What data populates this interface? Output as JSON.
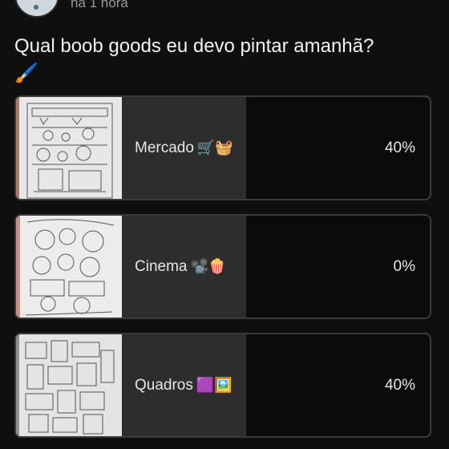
{
  "post": {
    "time": "há 1 hora",
    "question": "Qual boob goods eu devo pintar amanhã?",
    "question_emoji": "🖌️"
  },
  "poll": {
    "options": [
      {
        "label": "Mercado",
        "emoji": "🛒🧺",
        "percent": "40%",
        "fill_fraction": 0.55,
        "image": "coloring-page-thumbnail"
      },
      {
        "label": "Cinema",
        "emoji": "📽️🍿",
        "percent": "0%",
        "fill_fraction": 0.55,
        "image": "coloring-page-thumbnail"
      },
      {
        "label": "Quadros",
        "emoji": "🟪🖼️",
        "percent": "40%",
        "fill_fraction": 0.55,
        "image": "coloring-page-thumbnail"
      }
    ]
  }
}
